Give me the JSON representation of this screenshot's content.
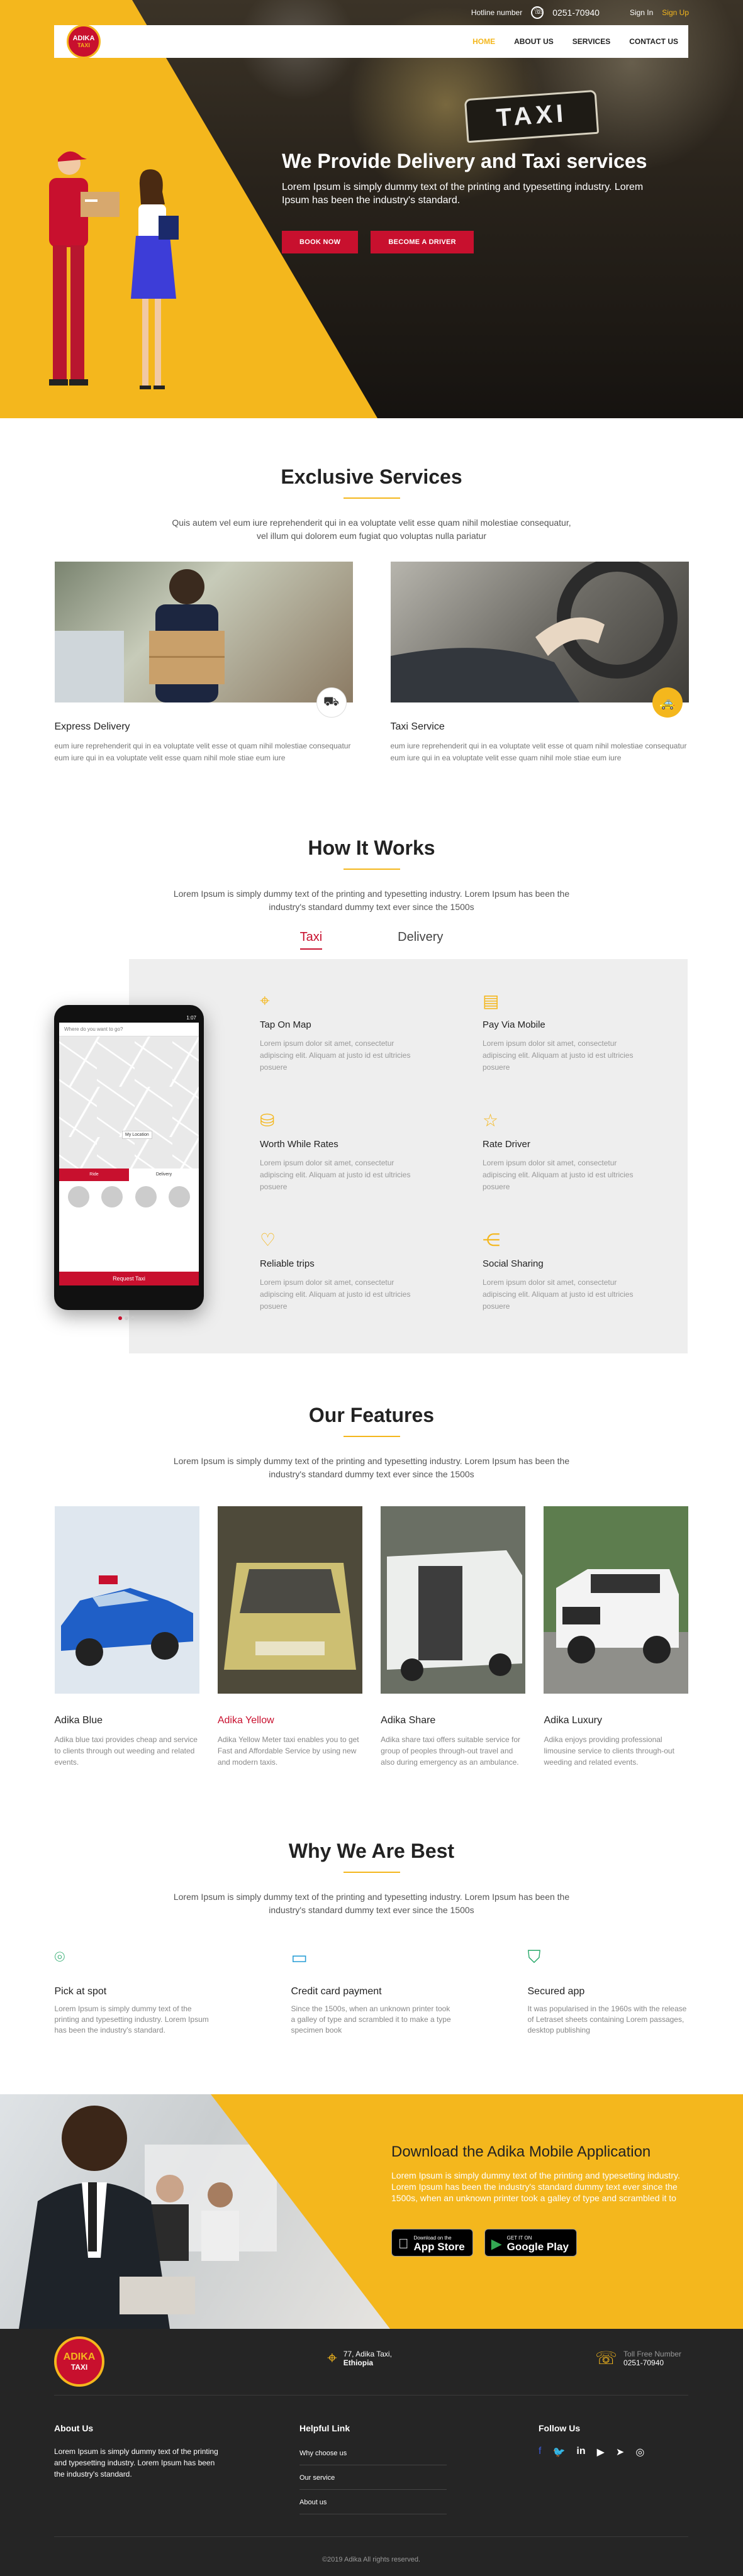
{
  "topbar": {
    "hotline_label": "Hotline number",
    "hotline_number": "0251-70940",
    "signin": "Sign In",
    "signup": "Sign Up"
  },
  "logo": {
    "text": "ADIKA",
    "sub": "TAXI"
  },
  "nav": {
    "items": [
      {
        "label": "HOME"
      },
      {
        "label": "ABOUT US"
      },
      {
        "label": "SERVICES"
      },
      {
        "label": "CONTACT US"
      }
    ]
  },
  "hero": {
    "sign": "TAXI",
    "title": "We Provide Delivery and Taxi services",
    "subtitle": "Lorem Ipsum is simply dummy text of the printing and typesetting industry. Lorem Ipsum has been the industry's standard.",
    "btn_book": "BOOK NOW",
    "btn_driver": "BECOME A DRIVER"
  },
  "services": {
    "title": "Exclusive Services",
    "subtitle": "Quis autem vel eum iure reprehenderit qui in ea voluptate velit esse quam nihil molestiae consequatur, vel illum qui dolorem eum fugiat quo voluptas nulla pariatur",
    "items": [
      {
        "title": "Express Delivery",
        "text": "eum iure reprehenderit qui in ea voluptate velit esse ot quam nihil molestiae consequatur eum iure qui in ea voluptate velit esse quam nihil mole stiae eum iure"
      },
      {
        "title": "Taxi Service",
        "text": "eum iure reprehenderit qui in ea voluptate velit esse ot quam nihil molestiae consequatur eum iure qui in ea voluptate velit esse quam nihil mole stiae eum iure"
      }
    ]
  },
  "how": {
    "title": "How It Works",
    "subtitle": "Lorem Ipsum is simply dummy text of the printing and typesetting industry. Lorem Ipsum has been the industry's standard dummy text ever since the 1500s",
    "tabs": [
      {
        "label": "Taxi"
      },
      {
        "label": "Delivery"
      }
    ],
    "phone": {
      "time": "1:07",
      "search": "Where do you want to go?",
      "tab_a": "Ride",
      "tab_b": "Delivery",
      "location": "My Location",
      "button": "Request Taxi"
    },
    "items": [
      {
        "title": "Tap On Map",
        "text": "Lorem ipsum dolor sit amet, consectetur adipiscing elit. Aliquam at justo id est ultricies posuere"
      },
      {
        "title": "Pay Via Mobile",
        "text": "Lorem ipsum dolor sit amet, consectetur adipiscing elit. Aliquam at justo id est ultricies posuere"
      },
      {
        "title": "Worth While Rates",
        "text": "Lorem ipsum dolor sit amet, consectetur adipiscing elit. Aliquam at justo id est ultricies posuere"
      },
      {
        "title": "Rate Driver",
        "text": "Lorem ipsum dolor sit amet, consectetur adipiscing elit. Aliquam at justo id est ultricies posuere"
      },
      {
        "title": "Reliable trips",
        "text": "Lorem ipsum dolor sit amet, consectetur adipiscing elit. Aliquam at justo id est ultricies posuere"
      },
      {
        "title": "Social Sharing",
        "text": "Lorem ipsum dolor sit amet, consectetur adipiscing elit. Aliquam at justo id est ultricies posuere"
      }
    ]
  },
  "features": {
    "title": "Our Features",
    "subtitle": "Lorem Ipsum is simply dummy text of the printing and typesetting industry. Lorem Ipsum has been the industry's standard dummy text ever since the 1500s",
    "items": [
      {
        "title": "Adika Blue",
        "text": "Adika blue taxi provides cheap and service to clients through out weeding and related events."
      },
      {
        "title": "Adika Yellow",
        "text": "Adika Yellow Meter taxi enables you to get Fast and Affordable Service by using new and modern taxis."
      },
      {
        "title": "Adika Share",
        "text": "Adika share taxi offers suitable service for group of peoples through-out travel and also during emergency as an ambulance."
      },
      {
        "title": "Adika Luxury",
        "text": "Adika enjoys providing professional limousine service to clients through-out weeding and related events."
      }
    ]
  },
  "why": {
    "title": "Why We Are Best",
    "subtitle": "Lorem Ipsum is simply dummy text of the printing and typesetting industry. Lorem Ipsum has been the industry's standard dummy text ever since the 1500s",
    "items": [
      {
        "title": "Pick at spot",
        "text": "Lorem Ipsum is simply dummy text of the printing and typesetting industry. Lorem Ipsum has been the industry's standard."
      },
      {
        "title": "Credit card payment",
        "text": "Since the 1500s, when an unknown printer took a galley of type and scrambled it to make a type specimen book"
      },
      {
        "title": "Secured app",
        "text": "It was popularised in the 1960s with the release of Letraset sheets containing Lorem passages, desktop publishing"
      }
    ]
  },
  "download": {
    "title": "Download the Adika Mobile  Application",
    "text": "Lorem Ipsum is simply dummy text of the printing and typesetting industry. Lorem Ipsum has been the industry's standard dummy text ever since the 1500s, when an unknown printer took a galley of type and scrambled it to",
    "appstore_small": "Download on the",
    "appstore_big": "App Store",
    "play_small": "GET IT ON",
    "play_big": "Google Play"
  },
  "footer": {
    "logo_text": "ADIKA",
    "logo_sub": "TAXI",
    "address_line1": "77, Adika Taxi,",
    "address_line2": "Ethiopia",
    "toll_label": "Toll Free Number",
    "toll_number": "0251-70940",
    "about_title": "About Us",
    "about_text": "Lorem Ipsum is simply dummy text of the printing and typesetting industry. Lorem Ipsum has been the industry's standard.",
    "help_title": "Helpful Link",
    "help_links": [
      {
        "label": "Why choose us"
      },
      {
        "label": "Our service"
      },
      {
        "label": "About us"
      }
    ],
    "follow_title": "Follow Us",
    "copyright": "©2019 Adika All rights reserved."
  },
  "colors": {
    "accent": "#f4b71d",
    "brand_red": "#c8102e",
    "footer_bg": "#252525"
  }
}
